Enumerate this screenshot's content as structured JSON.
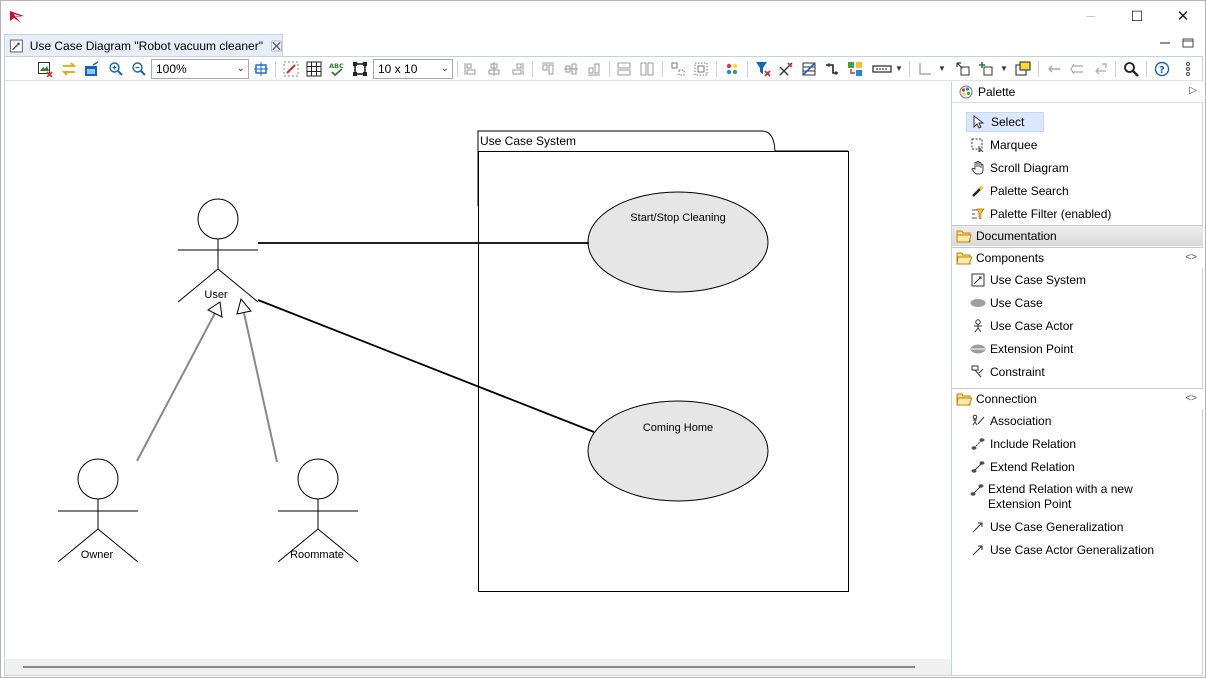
{
  "window": {
    "minimize": "─",
    "maximize": "☐",
    "close": "✕"
  },
  "editor_tab": {
    "label": "Use Case Diagram \"Robot vacuum cleaner\""
  },
  "toolbar": {
    "zoom": "100%",
    "grid_size": "10 x 10"
  },
  "diagram": {
    "system": {
      "label": "Use Case System"
    },
    "use_cases": [
      {
        "label": "Start/Stop Cleaning"
      },
      {
        "label": "Coming Home"
      }
    ],
    "actors": [
      {
        "label": "User"
      },
      {
        "label": "Owner"
      },
      {
        "label": "Roommate"
      }
    ]
  },
  "palette": {
    "title": "Palette",
    "tools": [
      {
        "label": "Select",
        "icon": "arrow-cursor-icon"
      },
      {
        "label": "Marquee",
        "icon": "marquee-icon"
      },
      {
        "label": "Scroll Diagram",
        "icon": "hand-icon"
      },
      {
        "label": "Palette Search",
        "icon": "search-wand-icon"
      },
      {
        "label": "Palette Filter (enabled)",
        "icon": "filter-icon"
      }
    ],
    "drawers": {
      "documentation": "Documentation",
      "components": "Components",
      "connection": "Connection"
    },
    "components": [
      {
        "label": "Use Case System",
        "icon": "system-icon"
      },
      {
        "label": "Use Case",
        "icon": "use-case-icon"
      },
      {
        "label": "Use Case Actor",
        "icon": "actor-icon"
      },
      {
        "label": "Extension Point",
        "icon": "extension-point-icon"
      },
      {
        "label": "Constraint",
        "icon": "constraint-icon"
      }
    ],
    "connections": [
      {
        "label": "Association",
        "icon": "association-icon"
      },
      {
        "label": "Include Relation",
        "icon": "include-icon"
      },
      {
        "label": "Extend Relation",
        "icon": "extend-icon"
      },
      {
        "label": "Extend Relation with a new Extension Point",
        "icon": "extend-new-icon"
      },
      {
        "label": "Use Case Generalization",
        "icon": "generalization-icon"
      },
      {
        "label": "Use Case Actor Generalization",
        "icon": "actor-generalization-icon"
      }
    ]
  }
}
